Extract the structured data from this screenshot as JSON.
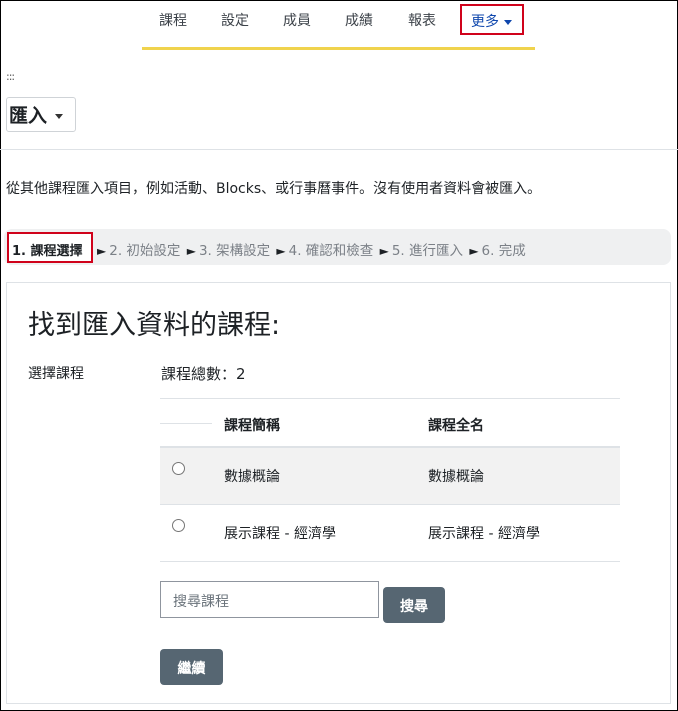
{
  "nav": {
    "items": [
      "課程",
      "設定",
      "成員",
      "成績",
      "報表"
    ],
    "more_label": "更多"
  },
  "breadcrumb_dots": ":::",
  "import_selector": {
    "label": "匯入"
  },
  "intro_text": "從其他課程匯入項目，例如活動、Blocks、或行事曆事件。沒有使用者資料會被匯入。",
  "stepper": {
    "current": "1. 課程選擇",
    "steps": [
      "2. 初始設定",
      "3. 架構設定",
      "4. 確認和檢查",
      "5. 進行匯入",
      "6. 完成"
    ],
    "separator": "►"
  },
  "panel": {
    "title": "找到匯入資料的課程:",
    "select_label": "選擇課程",
    "course_total": "課程總數：2",
    "table": {
      "headers": [
        "課程簡稱",
        "課程全名"
      ],
      "rows": [
        {
          "short": "數據概論",
          "full": "數據概論"
        },
        {
          "short": "展示課程 - 經濟學",
          "full": "展示課程 - 經濟學"
        }
      ]
    },
    "search": {
      "placeholder": "搜尋課程",
      "button": "搜尋"
    },
    "continue_button": "繼續"
  },
  "colors": {
    "accent": "#f0d34d",
    "highlight": "#d0021b",
    "button": "#566672",
    "link": "#0f47ad"
  }
}
